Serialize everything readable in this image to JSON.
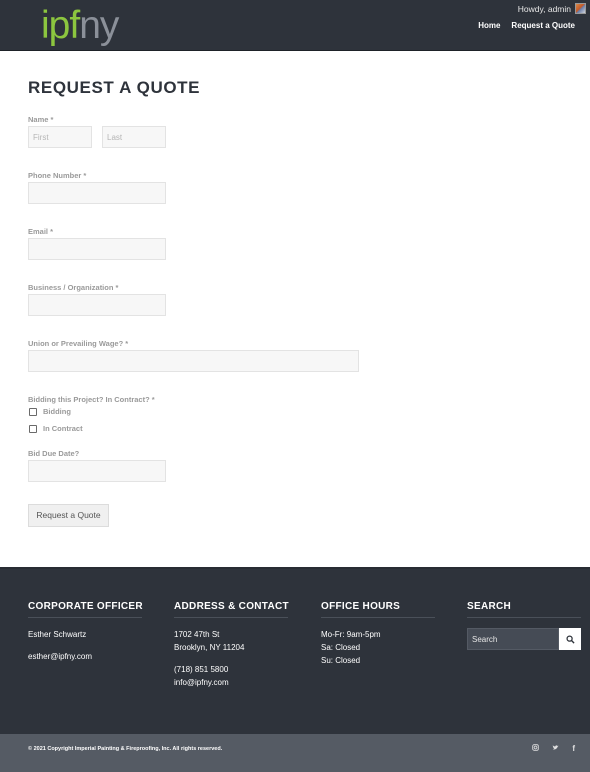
{
  "header": {
    "logo_part1": "ipf",
    "logo_part2": "ny",
    "howdy": "Howdy, admin",
    "nav": [
      {
        "label": "Home"
      },
      {
        "label": "Request a Quote"
      }
    ]
  },
  "form": {
    "title": "REQUEST A QUOTE",
    "name_label": "Name *",
    "first_placeholder": "First",
    "last_placeholder": "Last",
    "phone_label": "Phone Number *",
    "email_label": "Email *",
    "business_label": "Business / Organization *",
    "union_label": "Union or Prevailing Wage? *",
    "bidding_label": "Bidding this Project? In Contract? *",
    "options": [
      {
        "label": "Bidding",
        "checked": false
      },
      {
        "label": "In Contract",
        "checked": false
      }
    ],
    "bid_due_label": "Bid Due Date?",
    "submit_label": "Request a Quote"
  },
  "footer": {
    "corporate": {
      "title": "CORPORATE OFFICER",
      "name": "Esther Schwartz",
      "email": "esther@ipfny.com"
    },
    "address": {
      "title": "ADDRESS & CONTACT",
      "line1": "1702 47th St",
      "line2": "Brooklyn, NY 11204",
      "phone": "(718) 851 5800",
      "email": "info@ipfny.com"
    },
    "hours": {
      "title": "OFFICE HOURS",
      "line1": "Mo-Fr: 9am-5pm",
      "line2": "Sa: Closed",
      "line3": "Su: Closed"
    },
    "search": {
      "title": "SEARCH",
      "placeholder": "Search"
    },
    "copyright": "© 2021 Copyright Imperial Painting & Fireproofing, Inc. All rights reserved.",
    "social": [
      {
        "icon": "instagram-icon",
        "glyph": "◎"
      },
      {
        "icon": "twitter-icon",
        "glyph": "🐦"
      },
      {
        "icon": "facebook-icon",
        "glyph": "f"
      }
    ]
  }
}
